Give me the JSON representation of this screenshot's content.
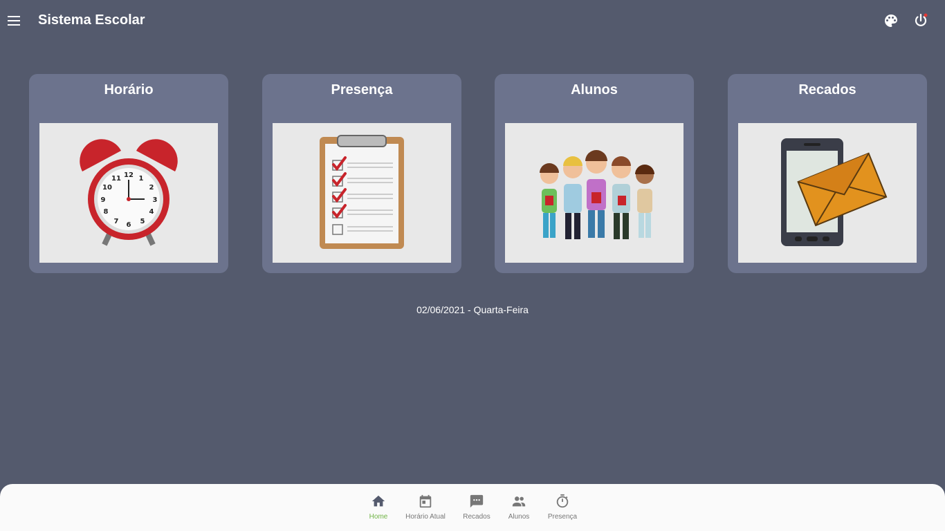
{
  "header": {
    "title": "Sistema Escolar",
    "icons": [
      "menu-icon",
      "palette-icon",
      "power-icon"
    ]
  },
  "cards": [
    {
      "title": "Horário",
      "image": "alarm-clock-illustration"
    },
    {
      "title": "Presença",
      "image": "clipboard-checklist-illustration"
    },
    {
      "title": "Alunos",
      "image": "students-group-illustration"
    },
    {
      "title": "Recados",
      "image": "phone-message-illustration"
    }
  ],
  "date_text": "02/06/2021 - Quarta-Feira",
  "bottom_nav": {
    "items": [
      {
        "label": "Home",
        "icon": "home-icon",
        "active": true
      },
      {
        "label": "Horário Atual",
        "icon": "calendar-icon",
        "active": false
      },
      {
        "label": "Recados",
        "icon": "chat-icon",
        "active": false
      },
      {
        "label": "Alunos",
        "icon": "people-icon",
        "active": false
      },
      {
        "label": "Presença",
        "icon": "timer-icon",
        "active": false
      }
    ]
  },
  "colors": {
    "background": "#545a6d",
    "card": "#6c738d",
    "active_nav": "#6fb344",
    "nav_bar": "#fafafa"
  }
}
